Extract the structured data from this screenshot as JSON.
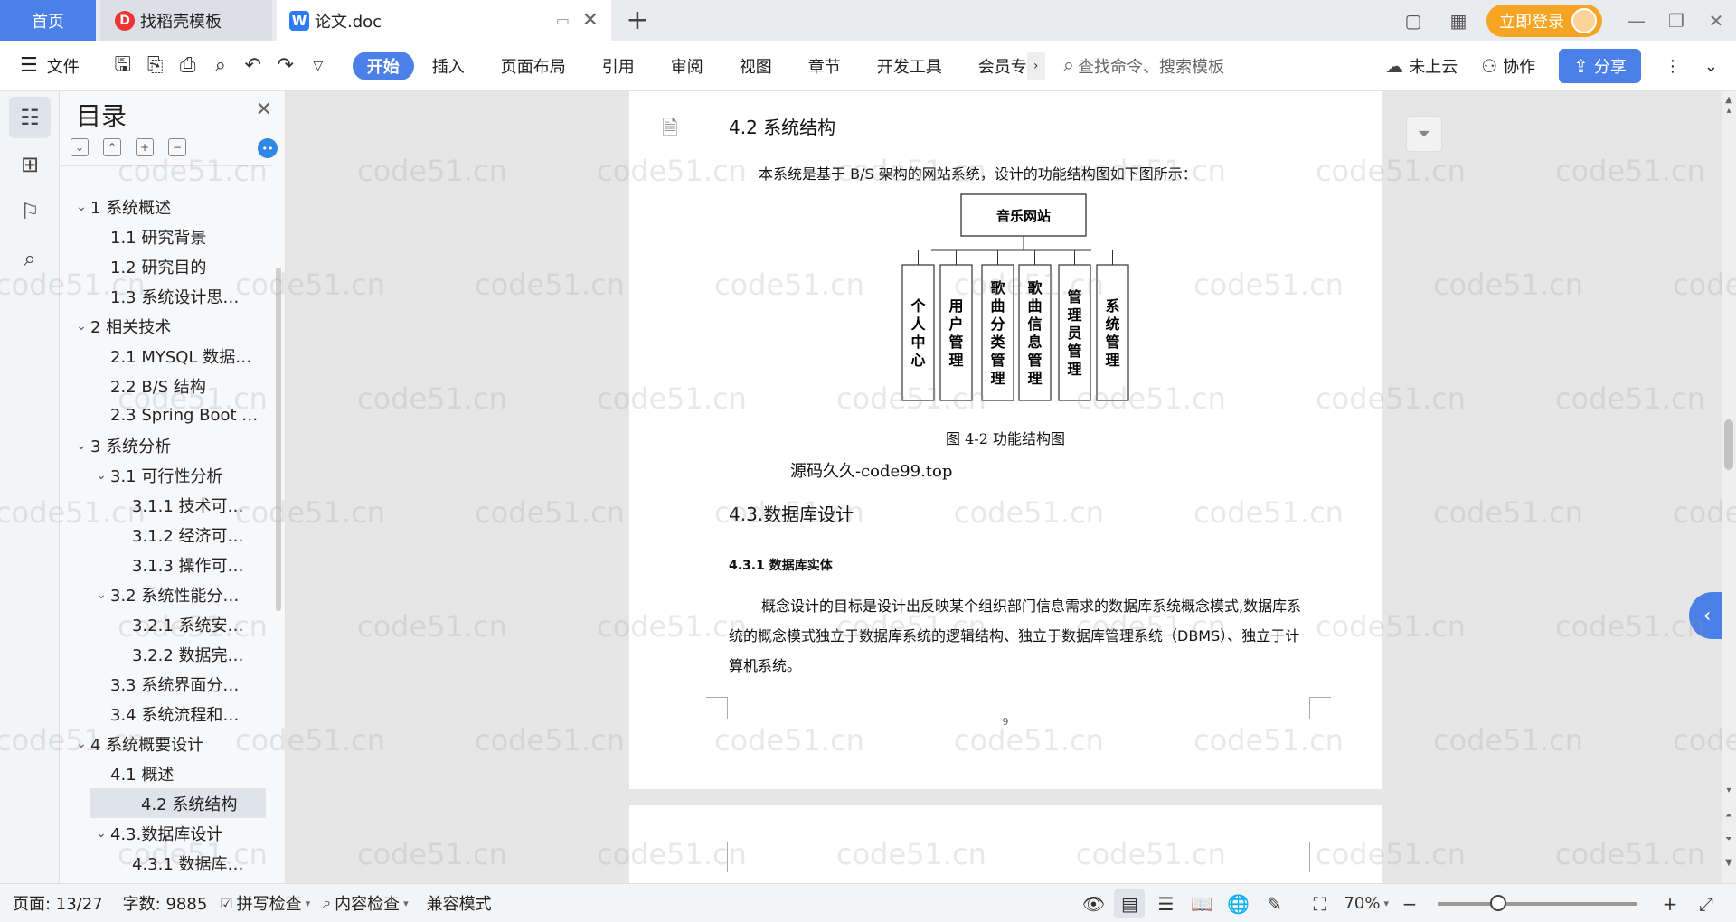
{
  "tabs": {
    "home": "首页",
    "template": "找稻壳模板",
    "doc": "论文.doc",
    "plus": "+"
  },
  "topbar": {
    "login_label": "立即登录"
  },
  "toolbar": {
    "file_label": "文件",
    "tabs": [
      "开始",
      "插入",
      "页面布局",
      "引用",
      "审阅",
      "视图",
      "章节",
      "开发工具",
      "会员专"
    ],
    "search_placeholder": "查找命令、搜索模板",
    "cloud_label": "未上云",
    "collab_label": "协作",
    "share_label": "分享"
  },
  "outline": {
    "title": "目录",
    "items": [
      {
        "label": "1 系统概述"
      },
      {
        "label": "1.1 研究背景"
      },
      {
        "label": "1.2 研究目的"
      },
      {
        "label": "1.3 系统设计思…"
      },
      {
        "label": "2 相关技术"
      },
      {
        "label": "2.1 MYSQL 数据…"
      },
      {
        "label": "2.2 B/S 结构"
      },
      {
        "label": "2.3 Spring Boot …"
      },
      {
        "label": "3 系统分析"
      },
      {
        "label": "3.1 可行性分析"
      },
      {
        "label": "3.1.1 技术可…"
      },
      {
        "label": "3.1.2 经济可…"
      },
      {
        "label": "3.1.3 操作可…"
      },
      {
        "label": "3.2 系统性能分…"
      },
      {
        "label": "3.2.1  系统安…"
      },
      {
        "label": "3.2.2  数据完…"
      },
      {
        "label": "3.3 系统界面分…"
      },
      {
        "label": "3.4 系统流程和…"
      },
      {
        "label": "4 系统概要设计"
      },
      {
        "label": "4.1 概述"
      },
      {
        "label": "4.2 系统结构"
      },
      {
        "label": "4.3.数据库设计"
      },
      {
        "label": "4.3.1 数据库…"
      }
    ]
  },
  "document": {
    "heading_42": "4.2 系统结构",
    "intro": "本系统是基于 B/S 架构的网站系统，设计的功能结构图如下图所示：",
    "diagram": {
      "root": "音乐网站",
      "children": [
        "个人中心",
        "用户管理",
        "歌曲分类管理",
        "歌曲信息管理",
        "管理员管理",
        "系统管理"
      ]
    },
    "caption": "图 4-2 功能结构图",
    "source_note": "源码久久-code99.top",
    "heading_43": "4.3.数据库设计",
    "heading_431": "4.3.1 数据库实体",
    "body": "概念设计的目标是设计出反映某个组织部门信息需求的数据库系统概念模式,数据库系统的概念模式独立于数据库系统的逻辑结构、独立于数据库管理系统（DBMS）、独立于计算机系统。",
    "page_number": "9"
  },
  "statusbar": {
    "page": "页面: 13/27",
    "words": "字数: 9885",
    "spell": "拼写检查",
    "content": "内容检查",
    "compat": "兼容模式",
    "zoom": "70%"
  },
  "watermark": "code51.cn",
  "colors": {
    "accent": "#4b80e8",
    "login": "#f5a522"
  }
}
